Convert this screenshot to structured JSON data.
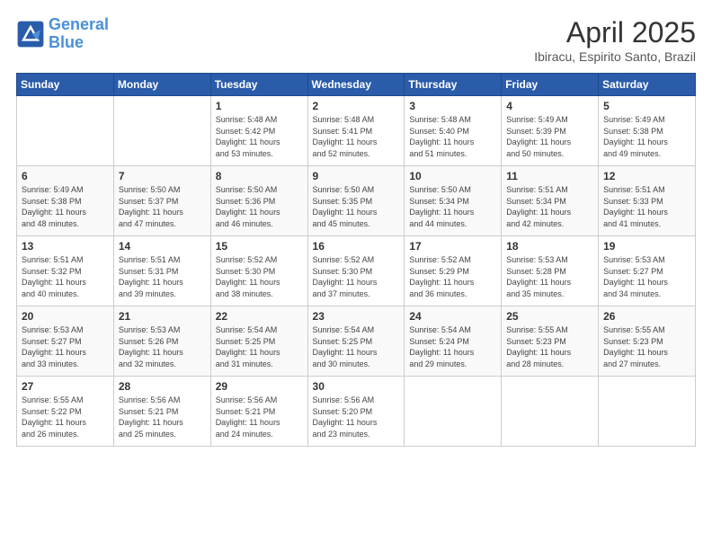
{
  "header": {
    "logo_line1": "General",
    "logo_line2": "Blue",
    "month_year": "April 2025",
    "location": "Ibiracu, Espirito Santo, Brazil"
  },
  "days_of_week": [
    "Sunday",
    "Monday",
    "Tuesday",
    "Wednesday",
    "Thursday",
    "Friday",
    "Saturday"
  ],
  "weeks": [
    [
      {
        "day": "",
        "content": ""
      },
      {
        "day": "",
        "content": ""
      },
      {
        "day": "1",
        "content": "Sunrise: 5:48 AM\nSunset: 5:42 PM\nDaylight: 11 hours\nand 53 minutes."
      },
      {
        "day": "2",
        "content": "Sunrise: 5:48 AM\nSunset: 5:41 PM\nDaylight: 11 hours\nand 52 minutes."
      },
      {
        "day": "3",
        "content": "Sunrise: 5:48 AM\nSunset: 5:40 PM\nDaylight: 11 hours\nand 51 minutes."
      },
      {
        "day": "4",
        "content": "Sunrise: 5:49 AM\nSunset: 5:39 PM\nDaylight: 11 hours\nand 50 minutes."
      },
      {
        "day": "5",
        "content": "Sunrise: 5:49 AM\nSunset: 5:38 PM\nDaylight: 11 hours\nand 49 minutes."
      }
    ],
    [
      {
        "day": "6",
        "content": "Sunrise: 5:49 AM\nSunset: 5:38 PM\nDaylight: 11 hours\nand 48 minutes."
      },
      {
        "day": "7",
        "content": "Sunrise: 5:50 AM\nSunset: 5:37 PM\nDaylight: 11 hours\nand 47 minutes."
      },
      {
        "day": "8",
        "content": "Sunrise: 5:50 AM\nSunset: 5:36 PM\nDaylight: 11 hours\nand 46 minutes."
      },
      {
        "day": "9",
        "content": "Sunrise: 5:50 AM\nSunset: 5:35 PM\nDaylight: 11 hours\nand 45 minutes."
      },
      {
        "day": "10",
        "content": "Sunrise: 5:50 AM\nSunset: 5:34 PM\nDaylight: 11 hours\nand 44 minutes."
      },
      {
        "day": "11",
        "content": "Sunrise: 5:51 AM\nSunset: 5:34 PM\nDaylight: 11 hours\nand 42 minutes."
      },
      {
        "day": "12",
        "content": "Sunrise: 5:51 AM\nSunset: 5:33 PM\nDaylight: 11 hours\nand 41 minutes."
      }
    ],
    [
      {
        "day": "13",
        "content": "Sunrise: 5:51 AM\nSunset: 5:32 PM\nDaylight: 11 hours\nand 40 minutes."
      },
      {
        "day": "14",
        "content": "Sunrise: 5:51 AM\nSunset: 5:31 PM\nDaylight: 11 hours\nand 39 minutes."
      },
      {
        "day": "15",
        "content": "Sunrise: 5:52 AM\nSunset: 5:30 PM\nDaylight: 11 hours\nand 38 minutes."
      },
      {
        "day": "16",
        "content": "Sunrise: 5:52 AM\nSunset: 5:30 PM\nDaylight: 11 hours\nand 37 minutes."
      },
      {
        "day": "17",
        "content": "Sunrise: 5:52 AM\nSunset: 5:29 PM\nDaylight: 11 hours\nand 36 minutes."
      },
      {
        "day": "18",
        "content": "Sunrise: 5:53 AM\nSunset: 5:28 PM\nDaylight: 11 hours\nand 35 minutes."
      },
      {
        "day": "19",
        "content": "Sunrise: 5:53 AM\nSunset: 5:27 PM\nDaylight: 11 hours\nand 34 minutes."
      }
    ],
    [
      {
        "day": "20",
        "content": "Sunrise: 5:53 AM\nSunset: 5:27 PM\nDaylight: 11 hours\nand 33 minutes."
      },
      {
        "day": "21",
        "content": "Sunrise: 5:53 AM\nSunset: 5:26 PM\nDaylight: 11 hours\nand 32 minutes."
      },
      {
        "day": "22",
        "content": "Sunrise: 5:54 AM\nSunset: 5:25 PM\nDaylight: 11 hours\nand 31 minutes."
      },
      {
        "day": "23",
        "content": "Sunrise: 5:54 AM\nSunset: 5:25 PM\nDaylight: 11 hours\nand 30 minutes."
      },
      {
        "day": "24",
        "content": "Sunrise: 5:54 AM\nSunset: 5:24 PM\nDaylight: 11 hours\nand 29 minutes."
      },
      {
        "day": "25",
        "content": "Sunrise: 5:55 AM\nSunset: 5:23 PM\nDaylight: 11 hours\nand 28 minutes."
      },
      {
        "day": "26",
        "content": "Sunrise: 5:55 AM\nSunset: 5:23 PM\nDaylight: 11 hours\nand 27 minutes."
      }
    ],
    [
      {
        "day": "27",
        "content": "Sunrise: 5:55 AM\nSunset: 5:22 PM\nDaylight: 11 hours\nand 26 minutes."
      },
      {
        "day": "28",
        "content": "Sunrise: 5:56 AM\nSunset: 5:21 PM\nDaylight: 11 hours\nand 25 minutes."
      },
      {
        "day": "29",
        "content": "Sunrise: 5:56 AM\nSunset: 5:21 PM\nDaylight: 11 hours\nand 24 minutes."
      },
      {
        "day": "30",
        "content": "Sunrise: 5:56 AM\nSunset: 5:20 PM\nDaylight: 11 hours\nand 23 minutes."
      },
      {
        "day": "",
        "content": ""
      },
      {
        "day": "",
        "content": ""
      },
      {
        "day": "",
        "content": ""
      }
    ]
  ]
}
